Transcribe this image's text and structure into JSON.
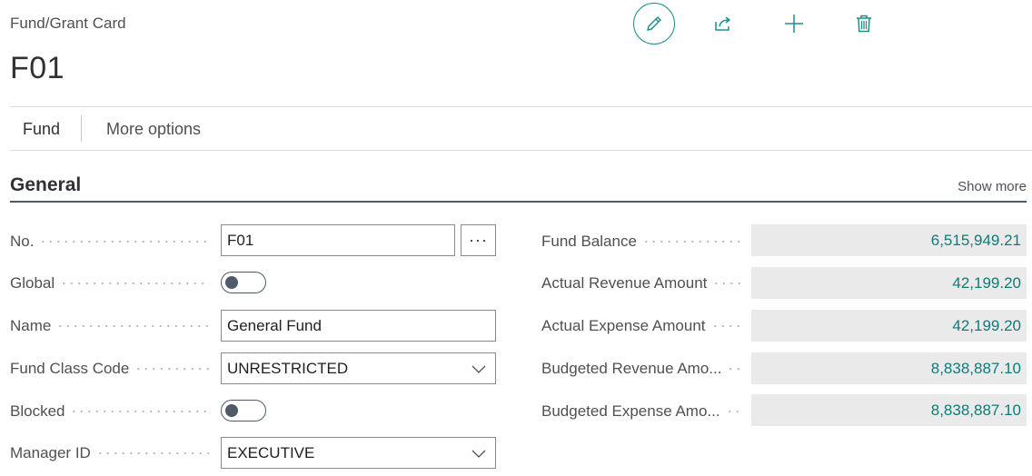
{
  "page": {
    "breadcrumb": "Fund/Grant Card",
    "record_title": "F01"
  },
  "actions": [
    {
      "name": "edit",
      "icon": "pencil-icon"
    },
    {
      "name": "share",
      "icon": "share-icon"
    },
    {
      "name": "new",
      "icon": "plus-icon"
    },
    {
      "name": "delete",
      "icon": "trash-icon"
    }
  ],
  "tabs": {
    "fund": "Fund",
    "more_options": "More options"
  },
  "section": {
    "title": "General",
    "show_more": "Show more"
  },
  "fields": {
    "no": {
      "label": "No.",
      "value": "F01",
      "assist": "···"
    },
    "global": {
      "label": "Global",
      "on": false
    },
    "name": {
      "label": "Name",
      "value": "General Fund"
    },
    "fund_class_code": {
      "label": "Fund Class Code",
      "value": "UNRESTRICTED"
    },
    "blocked": {
      "label": "Blocked",
      "on": false
    },
    "manager_id": {
      "label": "Manager ID",
      "value": "EXECUTIVE"
    }
  },
  "amounts": {
    "fund_balance": {
      "label": "Fund Balance",
      "value": "6,515,949.21"
    },
    "actual_revenue": {
      "label": "Actual Revenue Amount",
      "value": "42,199.20"
    },
    "actual_expense": {
      "label": "Actual Expense Amount",
      "value": "42,199.20"
    },
    "budgeted_revenue": {
      "label": "Budgeted Revenue Amo...",
      "value": "8,838,887.10"
    },
    "budgeted_expense": {
      "label": "Budgeted Expense Amo...",
      "value": "8,838,887.10"
    }
  },
  "colors": {
    "accent": "#1f8f8b",
    "value_text": "#0f7b78",
    "value_bg": "#eaeaea",
    "section_line": "#505a68"
  }
}
